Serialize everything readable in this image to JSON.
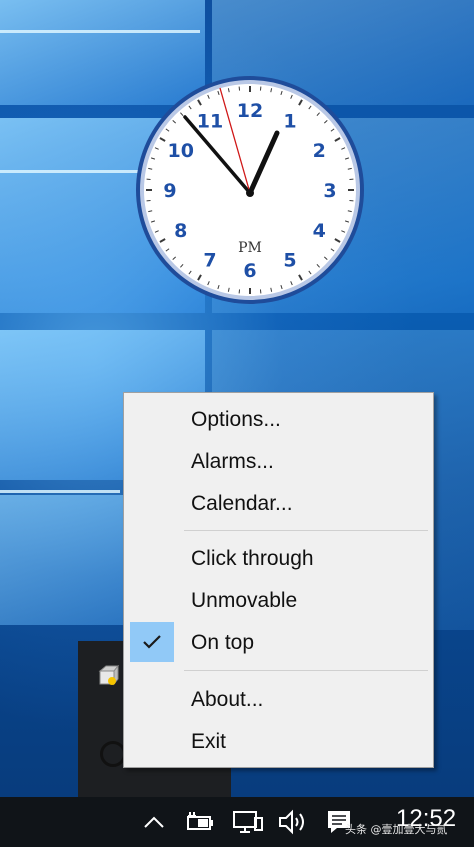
{
  "clock": {
    "period": "PM",
    "numerals": [
      "12",
      "1",
      "2",
      "3",
      "4",
      "5",
      "6",
      "7",
      "8",
      "9",
      "10",
      "11"
    ],
    "colors": {
      "face": "#ffffff",
      "rim": "#2e5fb0",
      "numerals": "#1e4fa6",
      "hands": "#111111",
      "second_hand": "#d01818"
    }
  },
  "context_menu": {
    "items": [
      {
        "label": "Options...",
        "checked": false
      },
      {
        "label": "Alarms...",
        "checked": false
      },
      {
        "label": "Calendar...",
        "checked": false
      },
      {
        "label": "Click through",
        "checked": false
      },
      {
        "label": "Unmovable",
        "checked": false
      },
      {
        "label": "On top",
        "checked": true
      },
      {
        "label": "About...",
        "checked": false
      },
      {
        "label": "Exit",
        "checked": false
      }
    ]
  },
  "taskbar": {
    "icons": [
      "chevron-up-icon",
      "battery-icon",
      "network-icon",
      "volume-icon",
      "notification-icon"
    ],
    "time": "12:52",
    "watermark": "头条 @壹加壹大与贰"
  }
}
